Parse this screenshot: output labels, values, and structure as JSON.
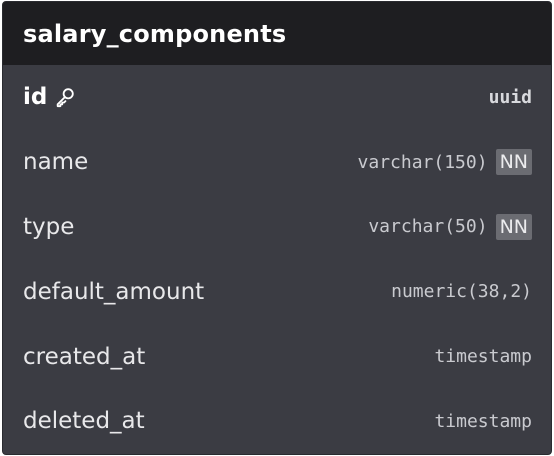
{
  "table": {
    "title": "salary_components",
    "columns": [
      {
        "name": "id",
        "type": "uuid",
        "primary_key": true,
        "not_null": false,
        "icon": "key-icon"
      },
      {
        "name": "name",
        "type": "varchar(150)",
        "primary_key": false,
        "not_null": true,
        "badge": "NN"
      },
      {
        "name": "type",
        "type": "varchar(50)",
        "primary_key": false,
        "not_null": true,
        "badge": "NN"
      },
      {
        "name": "default_amount",
        "type": "numeric(38,2)",
        "primary_key": false,
        "not_null": false
      },
      {
        "name": "created_at",
        "type": "timestamp",
        "primary_key": false,
        "not_null": false
      },
      {
        "name": "deleted_at",
        "type": "timestamp",
        "primary_key": false,
        "not_null": false
      }
    ]
  },
  "colors": {
    "header_bg": "#1e1e21",
    "body_bg": "#3b3c43",
    "badge_bg": "#6b6c72",
    "text": "#e8e8ea"
  }
}
